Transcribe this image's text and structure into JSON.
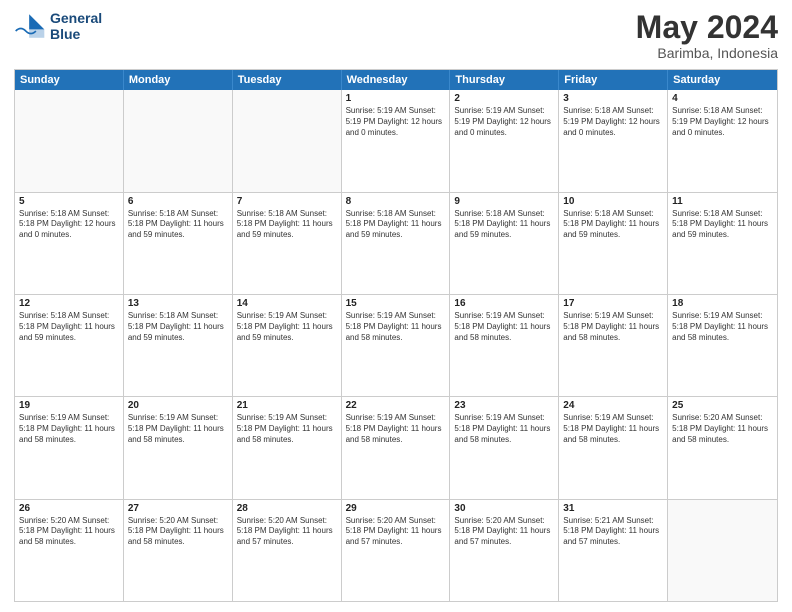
{
  "logo": {
    "line1": "General",
    "line2": "Blue"
  },
  "title": "May 2024",
  "subtitle": "Barimba, Indonesia",
  "days_of_week": [
    "Sunday",
    "Monday",
    "Tuesday",
    "Wednesday",
    "Thursday",
    "Friday",
    "Saturday"
  ],
  "weeks": [
    [
      {
        "day": "",
        "text": "",
        "empty": true
      },
      {
        "day": "",
        "text": "",
        "empty": true
      },
      {
        "day": "",
        "text": "",
        "empty": true
      },
      {
        "day": "1",
        "text": "Sunrise: 5:19 AM\nSunset: 5:19 PM\nDaylight: 12 hours\nand 0 minutes."
      },
      {
        "day": "2",
        "text": "Sunrise: 5:19 AM\nSunset: 5:19 PM\nDaylight: 12 hours\nand 0 minutes."
      },
      {
        "day": "3",
        "text": "Sunrise: 5:18 AM\nSunset: 5:19 PM\nDaylight: 12 hours\nand 0 minutes."
      },
      {
        "day": "4",
        "text": "Sunrise: 5:18 AM\nSunset: 5:19 PM\nDaylight: 12 hours\nand 0 minutes."
      }
    ],
    [
      {
        "day": "5",
        "text": "Sunrise: 5:18 AM\nSunset: 5:18 PM\nDaylight: 12 hours\nand 0 minutes."
      },
      {
        "day": "6",
        "text": "Sunrise: 5:18 AM\nSunset: 5:18 PM\nDaylight: 11 hours\nand 59 minutes."
      },
      {
        "day": "7",
        "text": "Sunrise: 5:18 AM\nSunset: 5:18 PM\nDaylight: 11 hours\nand 59 minutes."
      },
      {
        "day": "8",
        "text": "Sunrise: 5:18 AM\nSunset: 5:18 PM\nDaylight: 11 hours\nand 59 minutes."
      },
      {
        "day": "9",
        "text": "Sunrise: 5:18 AM\nSunset: 5:18 PM\nDaylight: 11 hours\nand 59 minutes."
      },
      {
        "day": "10",
        "text": "Sunrise: 5:18 AM\nSunset: 5:18 PM\nDaylight: 11 hours\nand 59 minutes."
      },
      {
        "day": "11",
        "text": "Sunrise: 5:18 AM\nSunset: 5:18 PM\nDaylight: 11 hours\nand 59 minutes."
      }
    ],
    [
      {
        "day": "12",
        "text": "Sunrise: 5:18 AM\nSunset: 5:18 PM\nDaylight: 11 hours\nand 59 minutes."
      },
      {
        "day": "13",
        "text": "Sunrise: 5:18 AM\nSunset: 5:18 PM\nDaylight: 11 hours\nand 59 minutes."
      },
      {
        "day": "14",
        "text": "Sunrise: 5:19 AM\nSunset: 5:18 PM\nDaylight: 11 hours\nand 59 minutes."
      },
      {
        "day": "15",
        "text": "Sunrise: 5:19 AM\nSunset: 5:18 PM\nDaylight: 11 hours\nand 58 minutes."
      },
      {
        "day": "16",
        "text": "Sunrise: 5:19 AM\nSunset: 5:18 PM\nDaylight: 11 hours\nand 58 minutes."
      },
      {
        "day": "17",
        "text": "Sunrise: 5:19 AM\nSunset: 5:18 PM\nDaylight: 11 hours\nand 58 minutes."
      },
      {
        "day": "18",
        "text": "Sunrise: 5:19 AM\nSunset: 5:18 PM\nDaylight: 11 hours\nand 58 minutes."
      }
    ],
    [
      {
        "day": "19",
        "text": "Sunrise: 5:19 AM\nSunset: 5:18 PM\nDaylight: 11 hours\nand 58 minutes."
      },
      {
        "day": "20",
        "text": "Sunrise: 5:19 AM\nSunset: 5:18 PM\nDaylight: 11 hours\nand 58 minutes."
      },
      {
        "day": "21",
        "text": "Sunrise: 5:19 AM\nSunset: 5:18 PM\nDaylight: 11 hours\nand 58 minutes."
      },
      {
        "day": "22",
        "text": "Sunrise: 5:19 AM\nSunset: 5:18 PM\nDaylight: 11 hours\nand 58 minutes."
      },
      {
        "day": "23",
        "text": "Sunrise: 5:19 AM\nSunset: 5:18 PM\nDaylight: 11 hours\nand 58 minutes."
      },
      {
        "day": "24",
        "text": "Sunrise: 5:19 AM\nSunset: 5:18 PM\nDaylight: 11 hours\nand 58 minutes."
      },
      {
        "day": "25",
        "text": "Sunrise: 5:20 AM\nSunset: 5:18 PM\nDaylight: 11 hours\nand 58 minutes."
      }
    ],
    [
      {
        "day": "26",
        "text": "Sunrise: 5:20 AM\nSunset: 5:18 PM\nDaylight: 11 hours\nand 58 minutes."
      },
      {
        "day": "27",
        "text": "Sunrise: 5:20 AM\nSunset: 5:18 PM\nDaylight: 11 hours\nand 58 minutes."
      },
      {
        "day": "28",
        "text": "Sunrise: 5:20 AM\nSunset: 5:18 PM\nDaylight: 11 hours\nand 57 minutes."
      },
      {
        "day": "29",
        "text": "Sunrise: 5:20 AM\nSunset: 5:18 PM\nDaylight: 11 hours\nand 57 minutes."
      },
      {
        "day": "30",
        "text": "Sunrise: 5:20 AM\nSunset: 5:18 PM\nDaylight: 11 hours\nand 57 minutes."
      },
      {
        "day": "31",
        "text": "Sunrise: 5:21 AM\nSunset: 5:18 PM\nDaylight: 11 hours\nand 57 minutes."
      },
      {
        "day": "",
        "text": "",
        "empty": true
      }
    ]
  ]
}
